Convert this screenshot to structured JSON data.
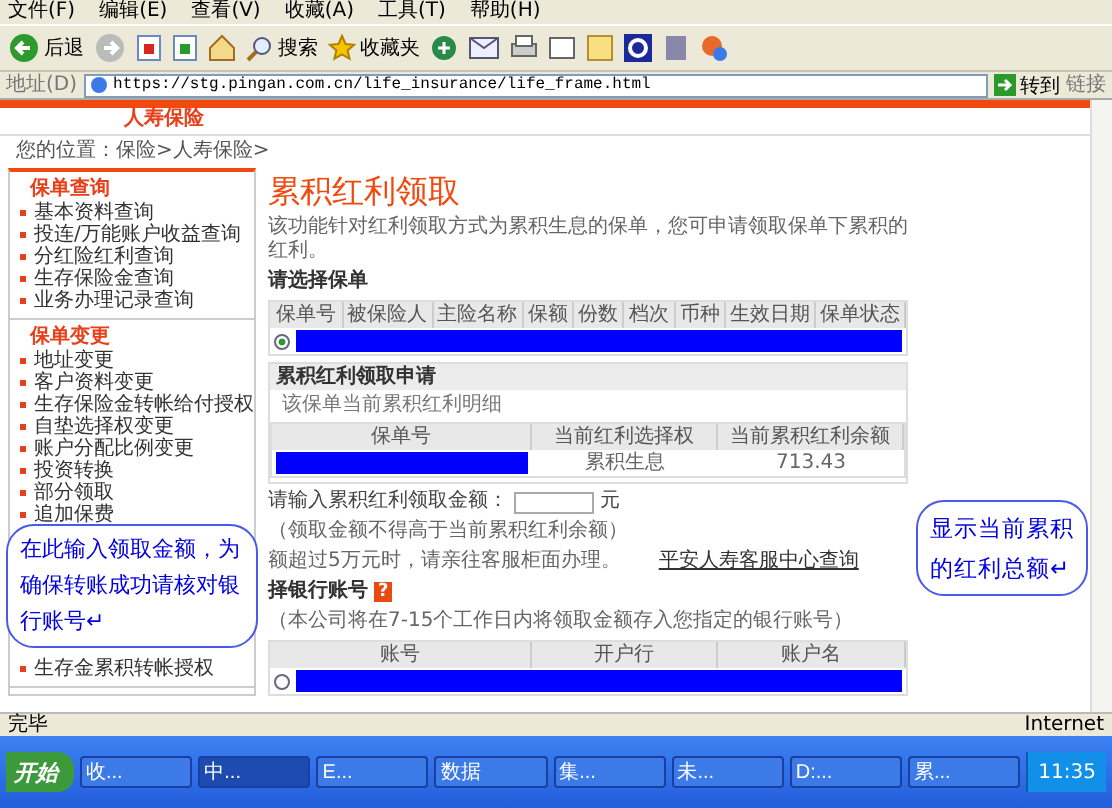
{
  "menu": [
    "文件(F)",
    "编辑(E)",
    "查看(V)",
    "收藏(A)",
    "工具(T)",
    "帮助(H)"
  ],
  "toolbar": {
    "back": "后退",
    "search": "搜索",
    "favorites": "收藏夹"
  },
  "address": {
    "label": "地址(D)",
    "url": "https://stg.pingan.com.cn/life_insurance/life_frame.html",
    "go": "转到",
    "links": "链接"
  },
  "site_tab": "人寿保险",
  "breadcrumb": "您的位置：保险>人寿保险>",
  "sidebar": [
    {
      "title": "保单查询",
      "items": [
        "基本资料查询",
        "投连/万能账户收益查询",
        "分红险红利查询",
        "生存保险金查询",
        "业务办理记录查询"
      ]
    },
    {
      "title": "保单变更",
      "items": [
        "地址变更",
        "客户资料变更",
        "生存保险金转帐给付授权",
        "自垫选择权变更",
        "账户分配比例变更",
        "投资转换",
        "部分领取",
        "追加保费"
      ],
      "items_below_callout": [
        "生存金累积转帐授权"
      ]
    }
  ],
  "page": {
    "title": "累积红利领取",
    "intro": "该功能针对红利领取方式为累积生息的保单，您可申请领取保单下累积的红利。"
  },
  "policy_select": {
    "label": "请选择保单",
    "columns": [
      "保单号",
      "被保险人",
      "主险名称",
      "保额",
      "份数",
      "档次",
      "币种",
      "生效日期",
      "保单状态"
    ],
    "rows": [
      {
        "selected": true
      }
    ]
  },
  "dividend": {
    "title": "累积红利领取申请",
    "caption": "该保单当前累积红利明细",
    "columns": [
      "保单号",
      "当前红利选择权",
      "当前累积红利余额"
    ],
    "rows": [
      {
        "option": "累积生息",
        "balance": "713.43"
      }
    ],
    "amount_label": "请输入累积红利领取金额：",
    "unit": "元",
    "amount_note": "（领取金额不得高于当前累积红利余额）",
    "notice": "额超过5万元时，请亲往客服柜面办理。",
    "link": "平安人寿客服中心查询"
  },
  "bank": {
    "label": "择银行账号",
    "help": "?",
    "note": "（本公司将在7-15个工作日内将领取金额存入您指定的银行账号）",
    "columns": [
      "账号",
      "开户行",
      "账户名"
    ],
    "rows": [
      {
        "selected": false
      }
    ]
  },
  "callout_amount": "在此输入领取金额，为确保转账成功请核对银行账号↵",
  "callout_total": "显示当前累积的红利总额↵",
  "status_bar": {
    "text": "完毕",
    "zone": "Internet"
  },
  "taskbar": {
    "start": "开始",
    "tasks": [
      {
        "label": "收...",
        "selected": false
      },
      {
        "label": "中...",
        "selected": true
      },
      {
        "label": "E...",
        "selected": false
      },
      {
        "label": "数据",
        "selected": false
      },
      {
        "label": "集...",
        "selected": false
      },
      {
        "label": "未...",
        "selected": false
      },
      {
        "label": "D:...",
        "selected": false
      },
      {
        "label": "累...",
        "selected": false
      }
    ],
    "clock": "11:35"
  }
}
